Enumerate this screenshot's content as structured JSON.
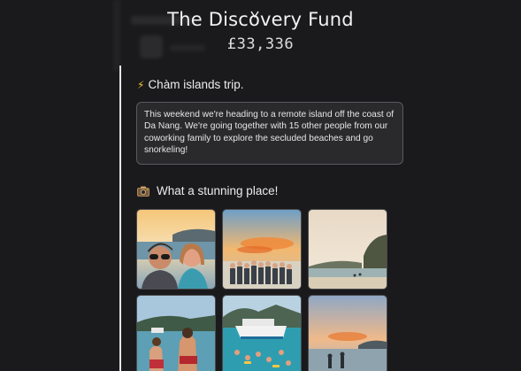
{
  "fund": {
    "title": "The Discovery Fund",
    "amount": "£33,336"
  },
  "entry": {
    "icon": "lightning-icon",
    "title": "Chàm islands trip.",
    "description": "This weekend we're heading to a remote island off the coast of Da Nang. We're going together with 15 other people from our coworking family to explore the secluded beaches and go snorkeling!"
  },
  "photos_section": {
    "icon": "camera-icon",
    "title": "What a stunning place!",
    "photos": [
      {
        "subject": "couple-selfie-photo"
      },
      {
        "subject": "group-sunset-photo"
      },
      {
        "subject": "beach-cove-photo"
      },
      {
        "subject": "wading-couple-photo"
      },
      {
        "subject": "boat-swimmers-photo"
      },
      {
        "subject": "sunset-beach-photo"
      }
    ]
  },
  "colors": {
    "background": "#1a1a1c",
    "timeline": "#e6e6e8",
    "accent_bolt": "#f2c230"
  }
}
